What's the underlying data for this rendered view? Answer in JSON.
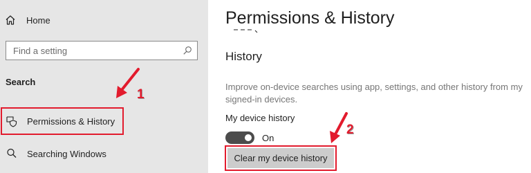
{
  "sidebar": {
    "home_label": "Home",
    "search": {
      "placeholder": "Find a setting"
    },
    "section_label": "Search",
    "items": [
      {
        "label": "Permissions & History",
        "icon": "permissions-history-icon",
        "highlighted": true
      },
      {
        "label": "Searching Windows",
        "icon": "search-icon"
      }
    ]
  },
  "main": {
    "title": "Permissions & History",
    "section_heading": "History",
    "description": "Improve on-device searches using app, settings, and other history from my signed-in devices.",
    "toggle": {
      "label": "My device history",
      "state_text": "On",
      "on": true
    },
    "clear_button_label": "Clear my device history"
  },
  "annotations": [
    {
      "number": "1",
      "points_to": "Permissions & History"
    },
    {
      "number": "2",
      "points_to": "Clear my device history"
    }
  ],
  "colors": {
    "sidebar_bg": "#e6e6e6",
    "highlight_red": "#e21b2d",
    "toggle_on": "#4c4c4c",
    "button_bg": "#cccccc",
    "muted_text": "#767676"
  }
}
